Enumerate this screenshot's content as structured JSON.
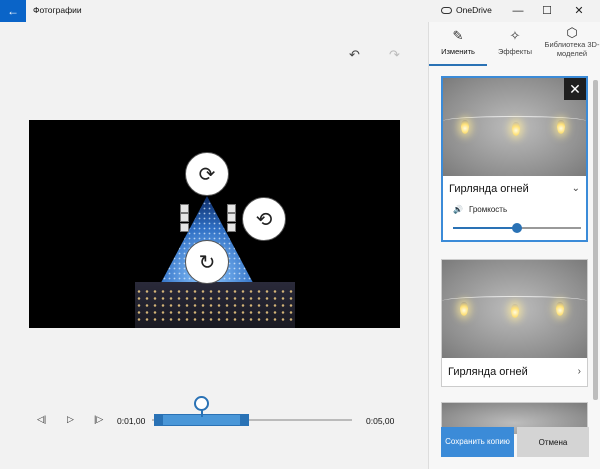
{
  "window": {
    "title": "Фотографии",
    "back_icon": "←",
    "onedrive_label": "OneDrive",
    "minimize": "—",
    "maximize": "☐",
    "close": "✕"
  },
  "toolbar": {
    "undo_icon": "↶",
    "redo_icon": "↷"
  },
  "timeline": {
    "prev_icon": "◁|",
    "play_icon": "▷",
    "next_icon": "|▷",
    "start_time": "0:01,00",
    "end_time": "0:05,00"
  },
  "tabs": [
    {
      "label": "Изменить",
      "icon": "✎",
      "active": true
    },
    {
      "label": "Эффекты",
      "icon": "✧",
      "active": false
    },
    {
      "label": "Библиотека 3D-моделей",
      "icon": "⬡",
      "active": false
    }
  ],
  "cards": [
    {
      "title": "Гирлянда огней",
      "chevron": "⌄",
      "close_icon": "✕",
      "volume_label": "Громкость",
      "volume_icon": "🔊",
      "volume_value": 0.5
    },
    {
      "title": "Гирлянда огней",
      "chevron": "›"
    }
  ],
  "buttons": {
    "save": "Сохранить копию",
    "cancel": "Отмена"
  },
  "colors": {
    "accent": "#2a72b5",
    "back_button": "#0a64c8"
  }
}
